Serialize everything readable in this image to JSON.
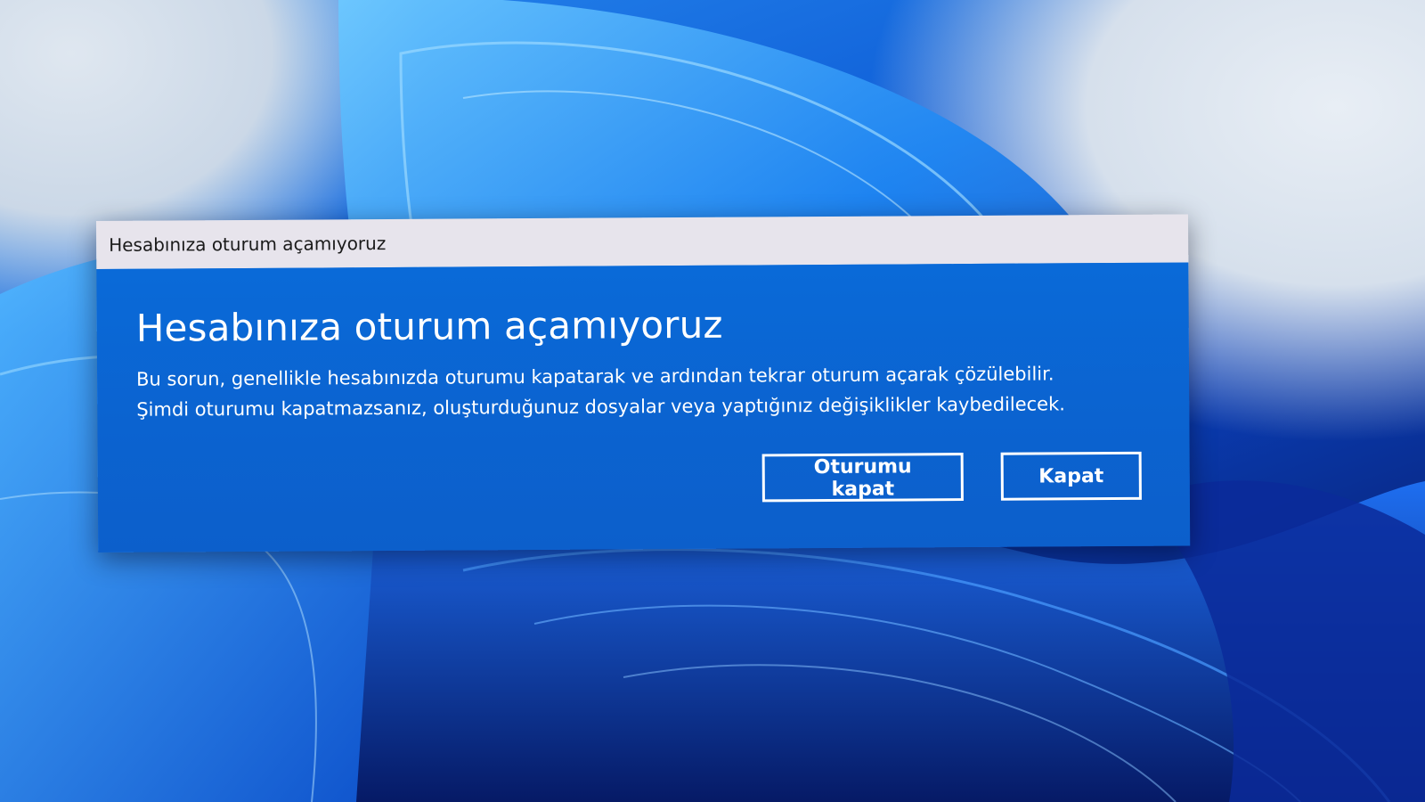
{
  "dialog": {
    "title": "Hesabınıza oturum açamıyoruz",
    "heading": "Hesabınıza oturum açamıyoruz",
    "message_line1": "Bu sorun, genellikle hesabınızda oturumu kapatarak ve ardından tekrar oturum açarak çözülebilir.",
    "message_line2": "Şimdi oturumu kapatmazsanız, oluşturduğunuz dosyalar veya yaptığınız değişiklikler kaybedilecek.",
    "buttons": {
      "sign_out": "Oturumu kapat",
      "close": "Kapat"
    }
  },
  "colors": {
    "dialog_body": "#0b63d0",
    "titlebar": "#e7e4ec",
    "text": "#ffffff"
  }
}
